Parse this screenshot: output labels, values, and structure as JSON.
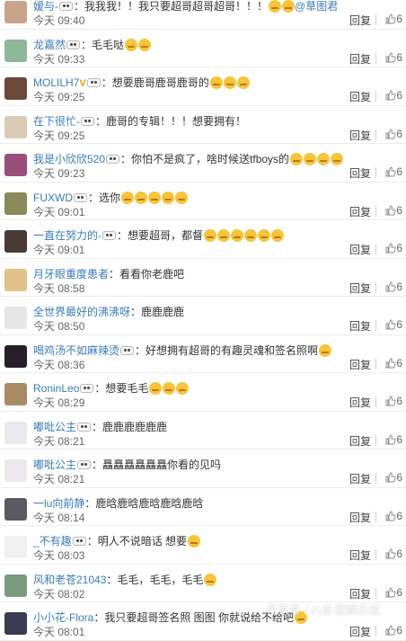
{
  "reply_label": "回复",
  "comments": [
    {
      "user": "嫒与-",
      "badge": true,
      "vip": false,
      "text": "：我我我！！我只要超哥超哥超哥！！！",
      "emoji_count": 2,
      "suffix": "@草图君",
      "time": "今天 09:40",
      "likes": "6",
      "avatar_color": "#c7a58d"
    },
    {
      "user": "龙嘉然",
      "badge": true,
      "vip": false,
      "text": "：毛毛哒",
      "emoji_count": 2,
      "suffix": "",
      "time": "今天 09:33",
      "likes": "6",
      "avatar_color": "#8fb79a"
    },
    {
      "user": "MOLILH7",
      "badge": true,
      "vip": true,
      "text": "：想要鹿哥鹿哥鹿哥的",
      "emoji_count": 3,
      "suffix": "",
      "time": "今天 09:25",
      "likes": "6",
      "avatar_color": "#6b4a3a"
    },
    {
      "user": "在下很忙-",
      "badge": true,
      "vip": false,
      "text": "：鹿哥的专辑！！！想要拥有！",
      "emoji_count": 0,
      "suffix": "",
      "time": "今天 09:25",
      "likes": "6",
      "avatar_color": "#d9cbb4"
    },
    {
      "user": "我是小欣欣520",
      "badge": true,
      "vip": false,
      "text": "：你怕不是疯了，啥时候送tfboys的",
      "emoji_count": 4,
      "suffix": "",
      "time": "今天 09:23",
      "likes": "6",
      "avatar_color": "#9a4f7a"
    },
    {
      "user": "FUXWD",
      "badge": true,
      "vip": false,
      "text": "：选你",
      "emoji_count": 5,
      "suffix": "",
      "time": "今天 09:01",
      "likes": "6",
      "avatar_color": "#8a8a5a"
    },
    {
      "user": "一直在努力的-",
      "badge": true,
      "vip": false,
      "text": "：想要超哥，都督",
      "emoji_count": 6,
      "suffix": "",
      "time": "今天 09:01",
      "likes": "6",
      "avatar_color": "#4a3a35"
    },
    {
      "user": "月牙眼重度患者",
      "badge": false,
      "vip": false,
      "text": "：看看你老鹿吧",
      "emoji_count": 0,
      "suffix": "",
      "time": "今天 08:58",
      "likes": "6",
      "avatar_color": "#e3c28a"
    },
    {
      "user": "全世界最好的沸沸呀",
      "badge": false,
      "vip": false,
      "text": "：鹿鹿鹿鹿",
      "emoji_count": 0,
      "suffix": "",
      "time": "今天 08:50",
      "likes": "6",
      "avatar_color": "#e6e6e6"
    },
    {
      "user": "喝鸡汤不如麻辣烫",
      "badge": true,
      "vip": false,
      "text": "：好想拥有超哥的有趣灵魂和签名照啊",
      "emoji_count": 1,
      "suffix": "",
      "time": "今天 08:36",
      "likes": "6",
      "avatar_color": "#2a1e2c"
    },
    {
      "user": "RoninLeo",
      "badge": true,
      "vip": false,
      "text": "：想要毛毛",
      "emoji_count": 3,
      "suffix": "",
      "time": "今天 08:29",
      "likes": "6",
      "avatar_color": "#a88a64"
    },
    {
      "user": "嘟吡公主",
      "badge": true,
      "vip": false,
      "text": "：鹿鹿鹿鹿鹿鹿",
      "emoji_count": 0,
      "suffix": "",
      "time": "今天 08:21",
      "likes": "6",
      "avatar_color": "#ece8f0"
    },
    {
      "user": "嘟吡公主",
      "badge": true,
      "vip": false,
      "text": "：矗矗矗矗矗矗你看的见吗",
      "emoji_count": 0,
      "suffix": "",
      "time": "今天 08:21",
      "likes": "6",
      "avatar_color": "#ece8f0"
    },
    {
      "user": "一lu向前静",
      "badge": false,
      "vip": false,
      "text": "：鹿晗鹿晗鹿晗鹿晗鹿晗",
      "emoji_count": 0,
      "suffix": "",
      "time": "今天 08:14",
      "likes": "6",
      "avatar_color": "#5a5a62"
    },
    {
      "user": "_不有趣",
      "badge": true,
      "vip": false,
      "text": "：明人不说暗话 想要",
      "emoji_count": 1,
      "suffix": "",
      "time": "今天 08:03",
      "likes": "6",
      "avatar_color": "#f0f0f0"
    },
    {
      "user": "风和老苍21043",
      "badge": false,
      "vip": false,
      "text": "：毛毛，毛毛，毛毛",
      "emoji_count": 1,
      "suffix": "",
      "time": "今天 08:02",
      "likes": "6",
      "avatar_color": "#7a9a7e"
    },
    {
      "user": "小小花-Flora",
      "badge": false,
      "vip": false,
      "text": "：我只要超哥签名照 图图 你就说给不给吧",
      "emoji_count": 1,
      "suffix": "",
      "time": "今天 08:01",
      "likes": "6",
      "avatar_color": "#3a3a50"
    }
  ],
  "watermark": "百家号 / 八卦君娱乐说"
}
